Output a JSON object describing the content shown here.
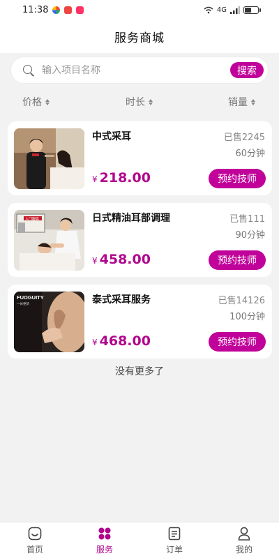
{
  "status_bar": {
    "time": "11:38",
    "signal_text": "4G"
  },
  "header": {
    "title": "服务商城"
  },
  "search": {
    "placeholder": "输入项目名称",
    "button_label": "搜索"
  },
  "sort": {
    "price": "价格",
    "duration": "时长",
    "sales": "销量"
  },
  "services": [
    {
      "title": "中式采耳",
      "sold": "已售2245",
      "duration": "60分钟",
      "currency": "¥",
      "price": "218.00",
      "button": "预约技师"
    },
    {
      "title": "日式精油耳部调理",
      "sold": "已售111",
      "duration": "90分钟",
      "currency": "¥",
      "price": "458.00",
      "button": "预约技师"
    },
    {
      "title": "泰式采耳服务",
      "sold": "已售14126",
      "duration": "100分钟",
      "currency": "¥",
      "price": "468.00",
      "button": "预约技师"
    }
  ],
  "thumb_texts": {
    "brand": "FUOGUITY",
    "brand_sub": "一体更新",
    "shop_sign": "入门服务"
  },
  "footer": {
    "no_more": "没有更多了"
  },
  "tabbar": {
    "items": [
      {
        "label": "首页",
        "icon": "home-icon",
        "active": false
      },
      {
        "label": "服务",
        "icon": "grid-icon",
        "active": true
      },
      {
        "label": "订单",
        "icon": "order-icon",
        "active": false
      },
      {
        "label": "我的",
        "icon": "user-icon",
        "active": false
      }
    ]
  },
  "colors": {
    "accent": "#c1029a",
    "price": "#b1078d",
    "background": "#f2f2f2"
  }
}
